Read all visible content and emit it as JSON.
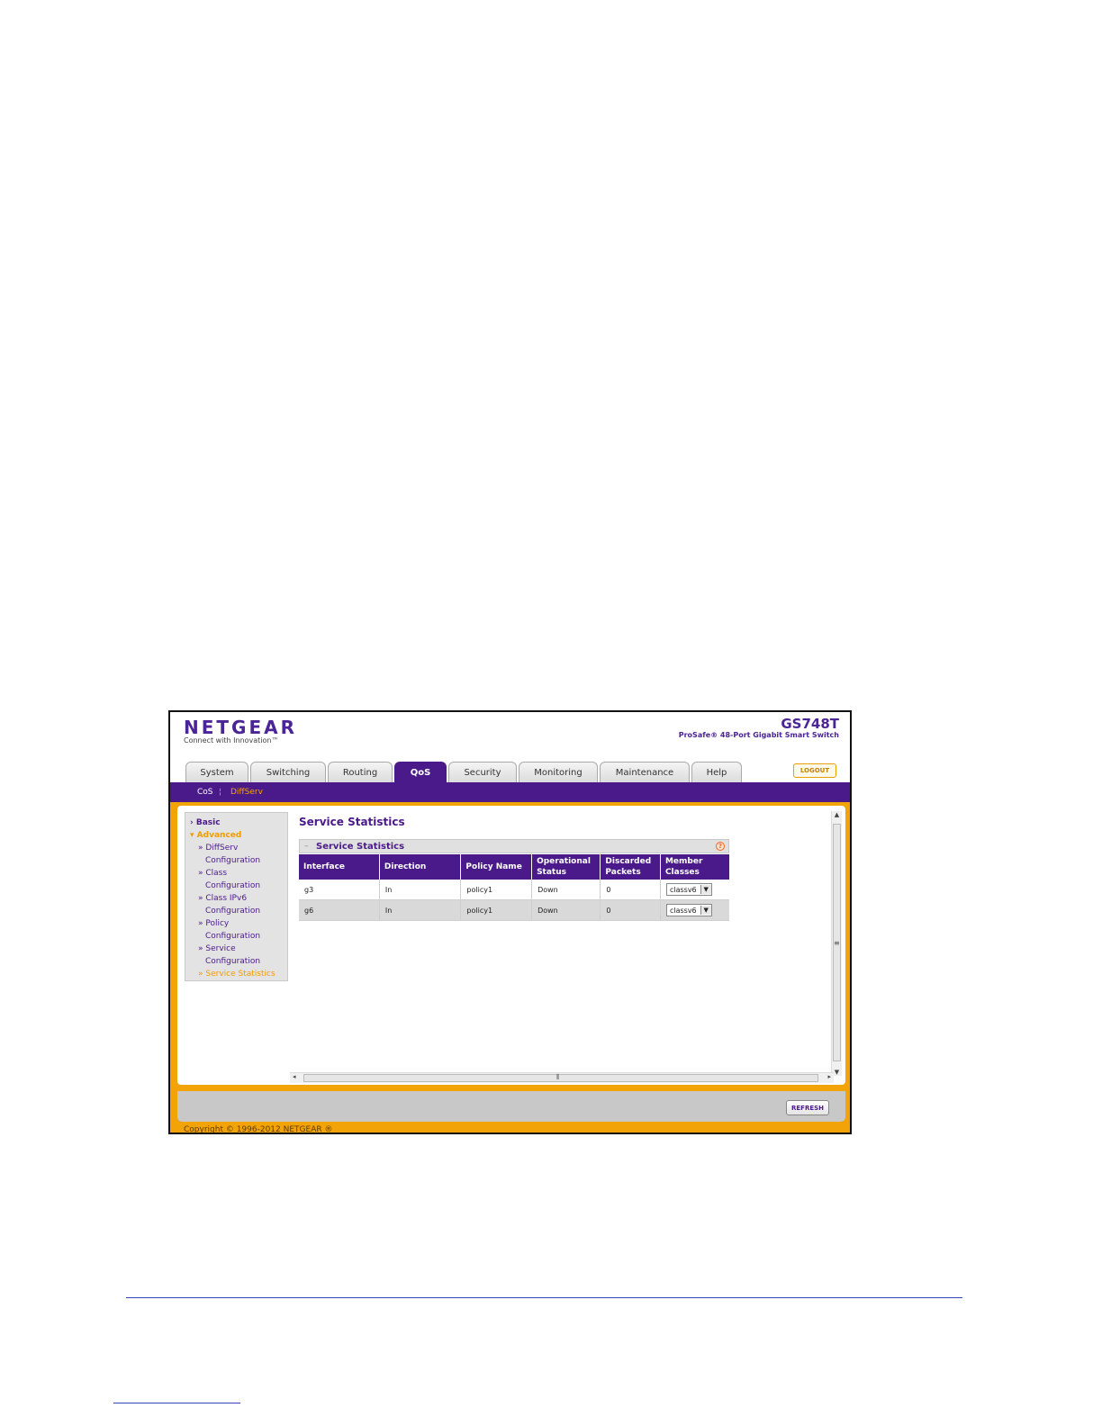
{
  "header": {
    "logo": "NETGEAR",
    "tagline": "Connect with Innovation™",
    "model": "GS748T",
    "model_desc": "ProSafe® 48-Port Gigabit Smart Switch",
    "logout": "LOGOUT"
  },
  "tabs": [
    {
      "label": "System"
    },
    {
      "label": "Switching"
    },
    {
      "label": "Routing"
    },
    {
      "label": "QoS",
      "active": true
    },
    {
      "label": "Security"
    },
    {
      "label": "Monitoring"
    },
    {
      "label": "Maintenance"
    },
    {
      "label": "Help"
    }
  ],
  "subnav": {
    "items": [
      "CoS",
      "DiffServ"
    ],
    "active": "DiffServ"
  },
  "sidebar": {
    "basic": "Basic",
    "advanced": "Advanced",
    "links": [
      {
        "line1": "» DiffServ",
        "line2": "Configuration"
      },
      {
        "line1": "» Class",
        "line2": "Configuration"
      },
      {
        "line1": "» Class IPv6",
        "line2": "Configuration"
      },
      {
        "line1": "» Policy",
        "line2": "Configuration"
      },
      {
        "line1": "» Service",
        "line2": "Configuration"
      }
    ],
    "active": "» Service Statistics"
  },
  "page": {
    "title": "Service Statistics",
    "panel_title": "Service Statistics"
  },
  "table": {
    "headers": [
      "Interface",
      "Direction",
      "Policy Name",
      "Operational Status",
      "Discarded Packets",
      "Member Classes"
    ],
    "rows": [
      {
        "interface": "g3",
        "direction": "In",
        "policy": "policy1",
        "status": "Down",
        "discarded": "0",
        "member": "classv6"
      },
      {
        "interface": "g6",
        "direction": "In",
        "policy": "policy1",
        "status": "Down",
        "discarded": "0",
        "member": "classv6"
      }
    ]
  },
  "footer": {
    "refresh": "REFRESH",
    "copyright": "Copyright © 1996-2012 NETGEAR ®"
  },
  "colors": {
    "brand_purple": "#4b1a8a",
    "accent_orange": "#f2a307"
  }
}
